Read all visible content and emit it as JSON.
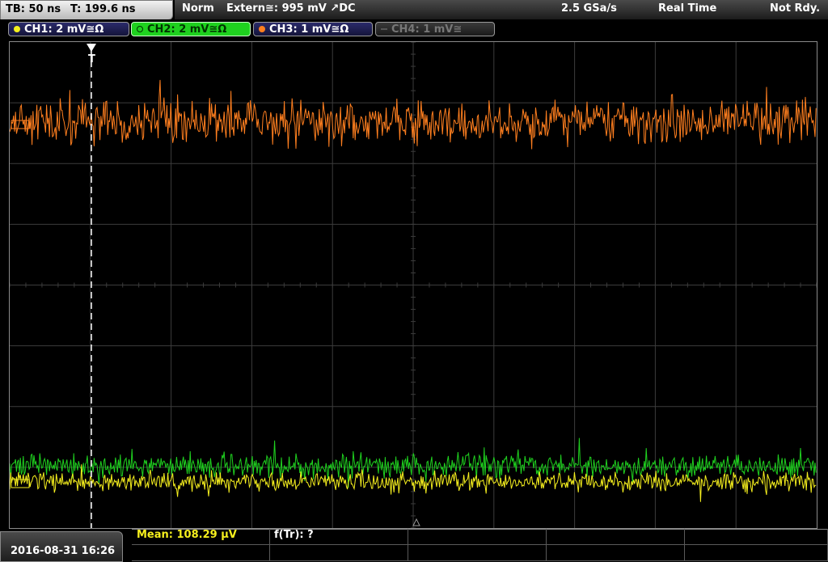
{
  "topbar": {
    "timebase": "TB: 50 ns",
    "trigger_time": "T: 199.6 ns",
    "trigger_mode": "Norm",
    "trigger_source": "Extern≅: 995 mV ↗DC",
    "sample_rate": "2.5 GSa/s",
    "acq_mode": "Real Time",
    "status": "Not Rdy."
  },
  "channels": [
    {
      "label": "CH1: 2 mV≅Ω",
      "color": "#f5ef1e",
      "state": "on"
    },
    {
      "label": "CH2: 2 mV≅Ω",
      "color": "#1fd11f",
      "state": "selected"
    },
    {
      "label": "CH3: 1 mV≅Ω",
      "color": "#ff7f1f",
      "state": "on"
    },
    {
      "label": "CH4: 1 mV≅",
      "color": "#777777",
      "state": "off"
    }
  ],
  "trigger_marker": "T",
  "bottom": {
    "datetime": "2016-08-31 16:26",
    "mean": "Mean: 108.29 µV",
    "ftr": "f(Tr): ?"
  },
  "colors": {
    "grid": "#3c3c3c",
    "trace_ch1": "#f5ef1e",
    "trace_ch2": "#1fd11f",
    "trace_ch3": "#ff7f1f",
    "trigger_line": "#ffffff"
  }
}
